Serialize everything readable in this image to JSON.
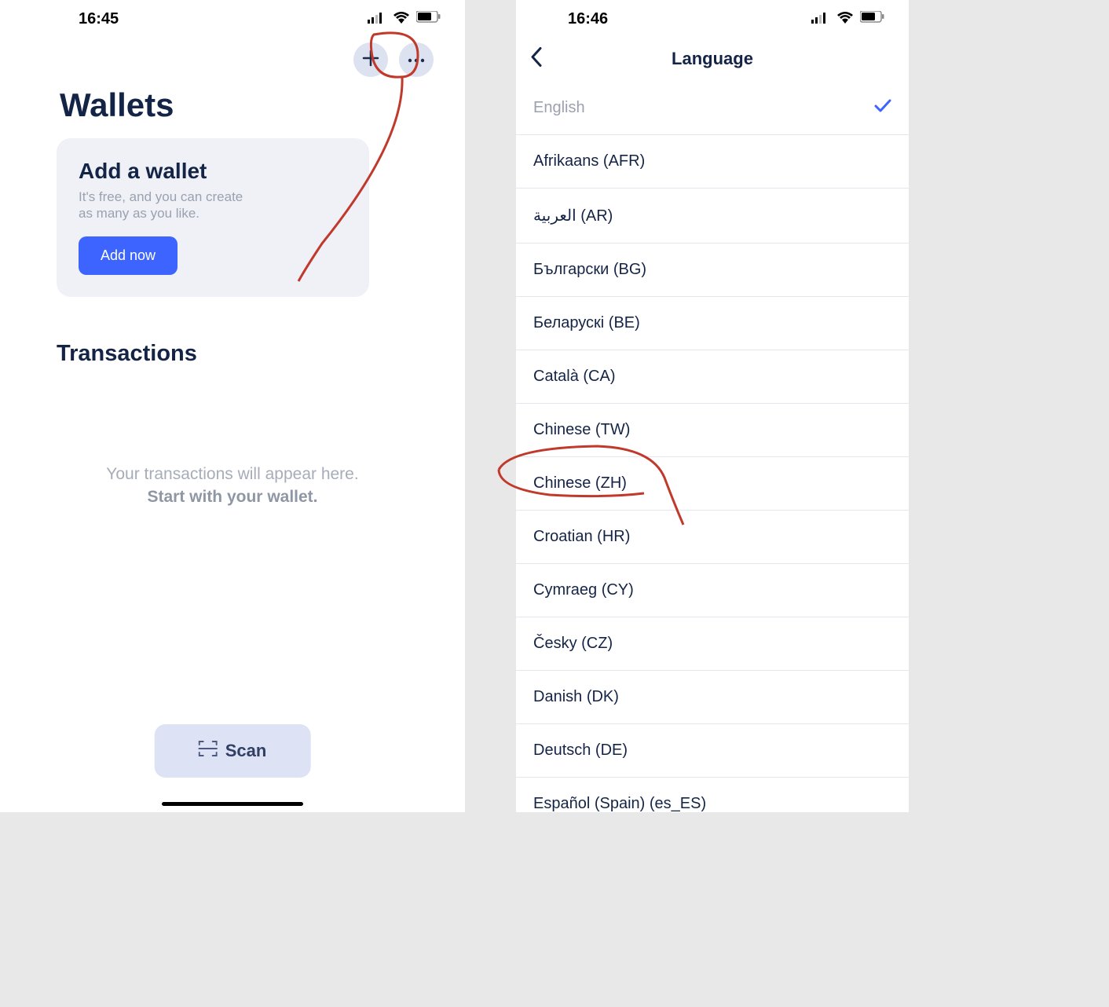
{
  "left": {
    "status_time": "16:45",
    "page_title": "Wallets",
    "add_card": {
      "title": "Add a wallet",
      "subtitle": "It's free, and you can create as many as you like.",
      "button": "Add now"
    },
    "transactions_title": "Transactions",
    "transactions_empty_line1": "Your transactions will appear here.",
    "transactions_empty_line2": "Start with your wallet.",
    "scan_label": "Scan"
  },
  "right": {
    "status_time": "16:46",
    "header_title": "Language",
    "languages": [
      {
        "label": "English",
        "selected": true
      },
      {
        "label": "Afrikaans (AFR)",
        "selected": false
      },
      {
        "label": "العربية (AR)",
        "selected": false
      },
      {
        "label": "Български (BG)",
        "selected": false
      },
      {
        "label": "Беларускі (BE)",
        "selected": false
      },
      {
        "label": "Català (CA)",
        "selected": false
      },
      {
        "label": "Chinese (TW)",
        "selected": false
      },
      {
        "label": "Chinese (ZH)",
        "selected": false
      },
      {
        "label": "Croatian (HR)",
        "selected": false
      },
      {
        "label": "Cymraeg (CY)",
        "selected": false
      },
      {
        "label": "Česky (CZ)",
        "selected": false
      },
      {
        "label": "Danish (DK)",
        "selected": false
      },
      {
        "label": "Deutsch (DE)",
        "selected": false
      },
      {
        "label": "Español (Spain) (es_ES)",
        "selected": false
      }
    ]
  }
}
